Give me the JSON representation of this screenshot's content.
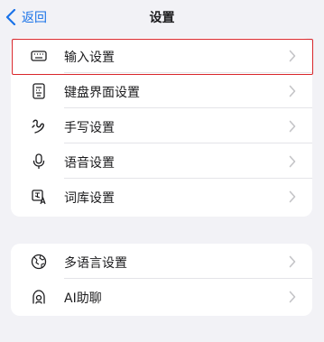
{
  "nav": {
    "back_label": "返回",
    "title": "设置"
  },
  "sections": [
    {
      "items": [
        {
          "label": "输入设置",
          "icon": "keyboard-icon",
          "highlighted": true
        },
        {
          "label": "键盘界面设置",
          "icon": "keyboard-layout-icon"
        },
        {
          "label": "手写设置",
          "icon": "handwriting-icon"
        },
        {
          "label": "语音设置",
          "icon": "microphone-icon"
        },
        {
          "label": "词库设置",
          "icon": "dictionary-icon"
        }
      ]
    },
    {
      "items": [
        {
          "label": "多语言设置",
          "icon": "globe-icon"
        },
        {
          "label": "AI助聊",
          "icon": "ai-chat-icon"
        }
      ]
    }
  ],
  "colors": {
    "accent": "#1a73e8",
    "highlight": "#d9262b",
    "background": "#f2f2f6"
  }
}
